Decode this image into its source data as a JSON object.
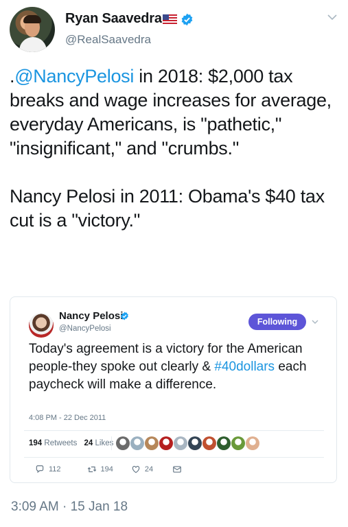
{
  "tweet": {
    "author_name": "Ryan Saavedra",
    "author_handle": "@RealSaavedra",
    "text_prefix": ".",
    "mention": "@NancyPelosi",
    "text_line1_rest": " in 2018: $2,000 tax breaks and wage increases for average, everyday Americans, is \"pathetic,\" \"insignificant,\" and \"crumbs.\"",
    "text_para2": "Nancy Pelosi in 2011: Obama's $40 tax cut is a \"victory.\"",
    "timestamp": "3:09 AM · 15 Jan 18",
    "icons": [
      "us-flag-icon",
      "verified-badge-icon",
      "chevron-down-icon"
    ]
  },
  "quoted": {
    "author_name": "Nancy Pelosi",
    "author_handle": "@NancyPelosi",
    "follow_label": "Following",
    "text_before": "Today's agreement is a victory for the American people-they spoke out clearly & ",
    "hashtag": "#40dollars",
    "text_after": " each paycheck will make a difference.",
    "time": "4:08 PM - 22 Dec 2011",
    "retweets_count": "194",
    "retweets_label": "Retweets",
    "likes_count": "24",
    "likes_label": "Likes",
    "actions": {
      "reply_count": "112",
      "retweet_count": "194",
      "like_count": "24"
    },
    "liker_avatar_colors": [
      "#6b6b6b",
      "#9ab0c0",
      "#b6875a",
      "#b52020",
      "#a9b6c2",
      "#334455",
      "#c05030",
      "#2e5e2e",
      "#6a9a3a",
      "#e0b090"
    ],
    "accent_color": "#5d55d8",
    "link_color": "#1b95e0"
  }
}
